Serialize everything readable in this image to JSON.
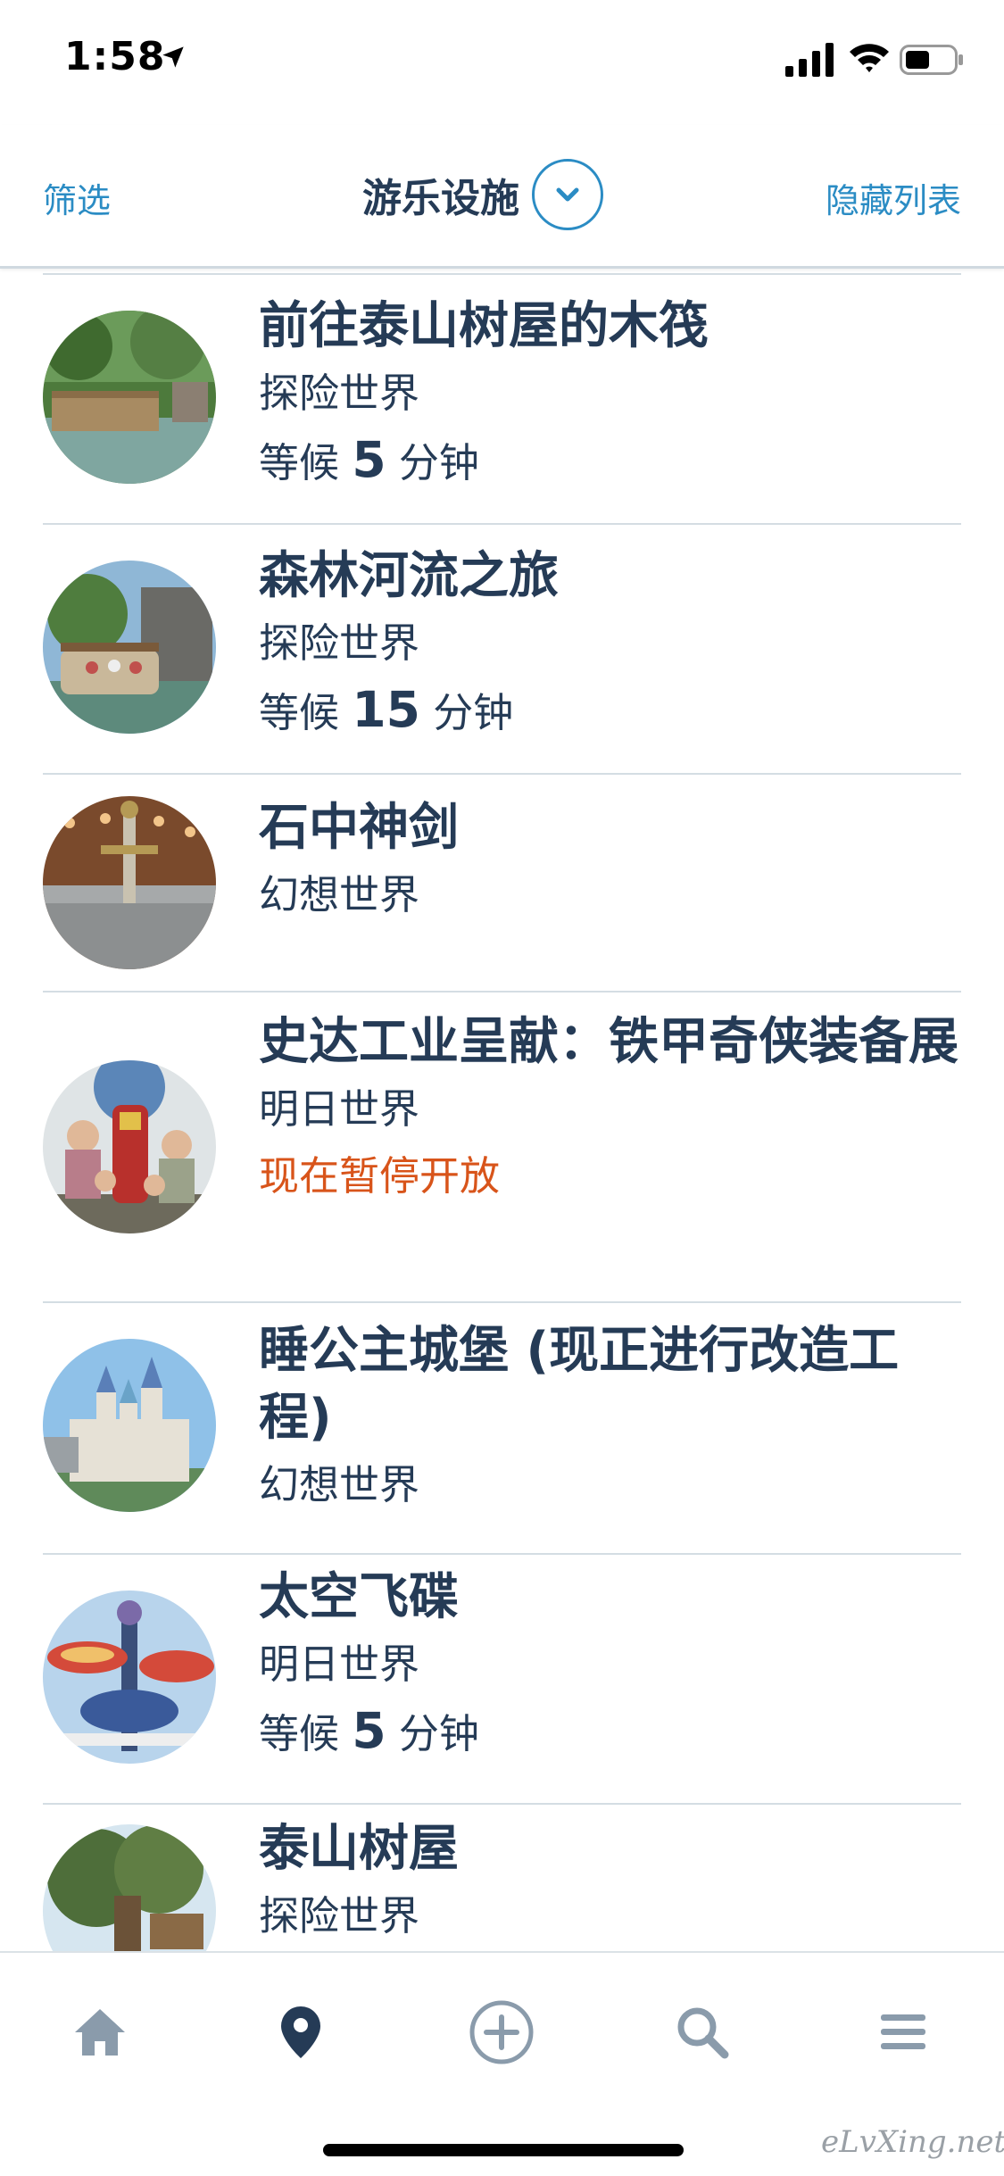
{
  "status_bar": {
    "time": "1:58"
  },
  "header": {
    "filter_label": "筛选",
    "title": "游乐设施",
    "hide_label": "隐藏列表"
  },
  "attractions": [
    {
      "title": "前往泰山树屋的木筏",
      "land": "探险世界",
      "wait_prefix": "等候",
      "wait_value": "5",
      "wait_unit": "分钟"
    },
    {
      "title": "森林河流之旅",
      "land": "探险世界",
      "wait_prefix": "等候",
      "wait_value": "15",
      "wait_unit": "分钟"
    },
    {
      "title": "石中神剑",
      "land": "幻想世界"
    },
    {
      "title": "史达工业呈献：铁甲奇侠装备展",
      "land": "明日世界",
      "status": "现在暂停开放"
    },
    {
      "title": "睡公主城堡 (现正进行改造工程)",
      "land": "幻想世界"
    },
    {
      "title": "太空飞碟",
      "land": "明日世界",
      "wait_prefix": "等候",
      "wait_value": "5",
      "wait_unit": "分钟"
    },
    {
      "title": "泰山树屋",
      "land": "探险世界"
    }
  ],
  "tab_bar": {
    "tabs": [
      {
        "icon": "home-icon",
        "active": false
      },
      {
        "icon": "map-pin-icon",
        "active": true
      },
      {
        "icon": "plus-circle-icon",
        "active": false
      },
      {
        "icon": "search-icon",
        "active": false
      },
      {
        "icon": "menu-icon",
        "active": false
      }
    ]
  },
  "watermark": "eLvXing.net",
  "colors": {
    "accent_blue": "#2b8cc4",
    "text_navy": "#253b56",
    "status_orange": "#d8541a",
    "tab_inactive": "#8a9bab"
  }
}
